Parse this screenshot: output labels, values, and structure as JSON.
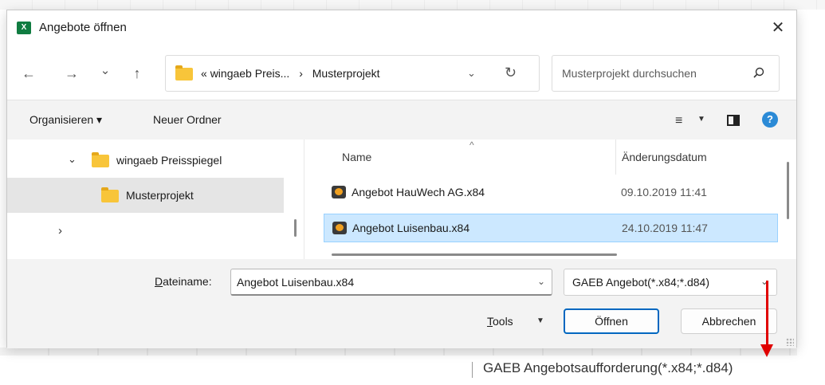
{
  "window": {
    "title": "Angebote öffnen",
    "app_icon_letter": "X",
    "close_glyph": "✕"
  },
  "nav": {
    "back_glyph": "←",
    "forward_glyph": "→",
    "recent_glyph": "⌄",
    "up_glyph": "↑",
    "address": {
      "prefix": "«",
      "crumb1": "wingaeb Preis...",
      "separator": "›",
      "crumb2": "Musterprojekt",
      "dropdown_glyph": "⌄",
      "refresh_glyph": "↻"
    },
    "search_placeholder": "Musterprojekt durchsuchen"
  },
  "toolbar": {
    "organize_label": "Organisieren ▾",
    "new_folder_label": "Neuer Ordner",
    "view_glyph": "≡",
    "view_dropdown_glyph": "▼",
    "help_glyph": "?"
  },
  "tree": {
    "items": [
      {
        "label": "wingaeb Preisspiegel",
        "chevron": "⌄"
      },
      {
        "label": "Musterprojekt",
        "chevron": ""
      },
      {
        "label": "",
        "chevron": "›"
      }
    ]
  },
  "files": {
    "columns": {
      "name": "Name",
      "modified": "Änderungsdatum"
    },
    "sort_glyph": "^",
    "rows": [
      {
        "name": "Angebot HauWech AG.x84",
        "modified": "09.10.2019 11:41"
      },
      {
        "name": "Angebot Luisenbau.x84",
        "modified": "24.10.2019 11:47"
      }
    ]
  },
  "bottom": {
    "filename_label_underlined": "D",
    "filename_label_rest": "ateiname:",
    "filename_value": "Angebot Luisenbau.x84",
    "filename_dropdown_glyph": "⌄",
    "filetype_value": "GAEB Angebot(*.x84;*.d84)",
    "filetype_dropdown_glyph": "⌄",
    "tools_underlined": "T",
    "tools_rest": "ools",
    "tools_dropdown_glyph": "▼",
    "open_label": "Öffnen",
    "cancel_label": "Abbrechen"
  },
  "annotation": {
    "callout_text": "GAEB Angebotsaufforderung(*.x84;*.d84)",
    "arrow_color": "#e00000"
  },
  "colors": {
    "selection": "#cce8ff",
    "primary_border": "#0067c0",
    "folder": "#f8c53a",
    "excel_green": "#107c41"
  }
}
